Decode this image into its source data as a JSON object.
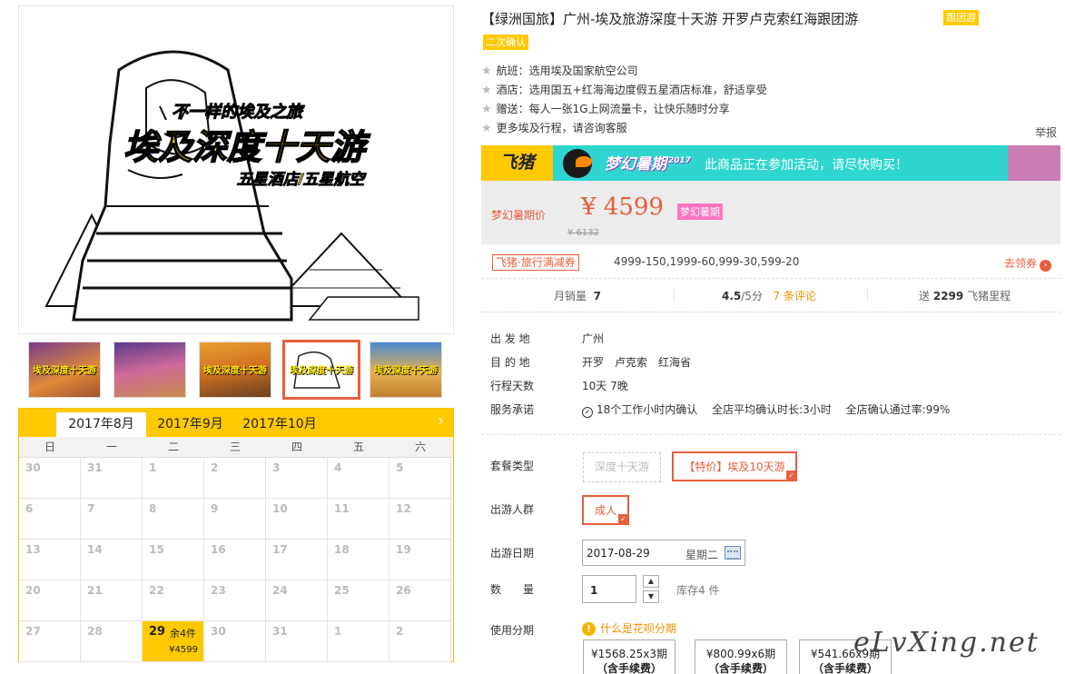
{
  "product": {
    "title": "【绿洲国旅】广州-埃及旅游深度十天游 开罗卢克索红海跟团游",
    "tag_follow": "跟团游",
    "tag_confirm": "二次确认",
    "features": [
      "航班：选用埃及国家航空公司",
      "酒店：选用国五+红海海边度假五星酒店标准，舒适享受",
      "赠送：每人一张1G上网流量卡，让快乐随时分享",
      "更多埃及行程，请咨询客服"
    ],
    "report": "举报"
  },
  "main_image": {
    "subtitle": "不一样的埃及之旅",
    "headline": "埃及深度十天游",
    "tagline": "五星酒店/五星航空"
  },
  "thumbnails": [
    "埃及深度十天游",
    "",
    "埃及深度十天游",
    "埃及深度十天游",
    "埃及深度十天游"
  ],
  "promo": {
    "brand": "飞猪",
    "event": "梦幻暑期",
    "year": "2017",
    "text": "此商品正在参加活动，请尽快购买！"
  },
  "price": {
    "label": "梦幻暑期价",
    "current": "¥ 4599",
    "badge": "梦幻暑期",
    "original": "¥ 6132"
  },
  "coupon": {
    "tag": "飞猪·旅行满减券",
    "text": "4999-150,1999-60,999-30,599-20",
    "get": "去领券"
  },
  "stats": {
    "monthly_label": "月销量",
    "monthly_value": "7",
    "rating": "4.5",
    "rating_suffix": "/5分",
    "reviews": "7 条评论",
    "miles_prefix": "送",
    "miles_value": "2299",
    "miles_suffix": "飞猪里程"
  },
  "info": [
    {
      "label": "出 发 地",
      "value": "广州"
    },
    {
      "label": "目 的 地",
      "value": "开罗　卢克索　红海省"
    },
    {
      "label": "行程天数",
      "value": "10天 7晚"
    },
    {
      "label": "服务承诺",
      "value": "18个工作小时内确认　 全店平均确认时长:3小时　 全店确认通过率:99%"
    }
  ],
  "package": {
    "label": "套餐类型",
    "options": [
      "深度十天游",
      "【特价】埃及10天游"
    ]
  },
  "travelers": {
    "label": "出游人群",
    "option": "成人"
  },
  "date": {
    "label": "出游日期",
    "value": "2017-08-29",
    "weekday": "星期二"
  },
  "quantity": {
    "label": "数　　量",
    "value": "1",
    "stock": "库存4 件"
  },
  "installment": {
    "label": "使用分期",
    "info": "什么是花呗分期",
    "options": [
      {
        "amount": "¥1568.25x3期",
        "fee": "（含手续费）"
      },
      {
        "amount": "¥800.99x6期",
        "fee": "（含手续费）"
      },
      {
        "amount": "¥541.66x9期",
        "fee": "（含手续费）"
      }
    ]
  },
  "calendar": {
    "tabs": [
      "2017年8月",
      "2017年9月",
      "2017年10月"
    ],
    "weekdays": [
      "日",
      "一",
      "二",
      "三",
      "四",
      "五",
      "六"
    ],
    "days": [
      "30",
      "31",
      "1",
      "2",
      "3",
      "4",
      "5",
      "6",
      "7",
      "8",
      "9",
      "10",
      "11",
      "12",
      "13",
      "14",
      "15",
      "16",
      "17",
      "18",
      "19",
      "20",
      "21",
      "22",
      "23",
      "24",
      "25",
      "26",
      "27",
      "28",
      "29",
      "30",
      "31",
      "1",
      "2"
    ],
    "available": {
      "day": "29",
      "stock": "余4件",
      "price": "¥4599"
    }
  },
  "watermark": "eLvXing.net",
  "colors": {
    "accent": "#e85e3c",
    "yellow": "#ffc900",
    "teal": "#2fd6cf"
  }
}
